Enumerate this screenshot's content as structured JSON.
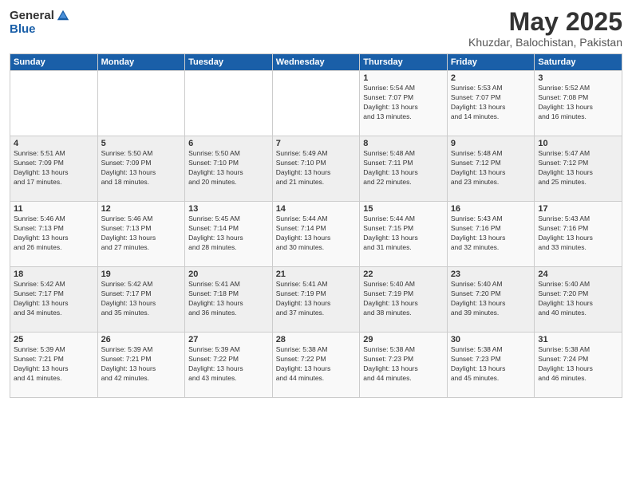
{
  "logo": {
    "general": "General",
    "blue": "Blue"
  },
  "header": {
    "title": "May 2025",
    "subtitle": "Khuzdar, Balochistan, Pakistan"
  },
  "weekdays": [
    "Sunday",
    "Monday",
    "Tuesday",
    "Wednesday",
    "Thursday",
    "Friday",
    "Saturday"
  ],
  "weeks": [
    [
      {
        "num": "",
        "info": ""
      },
      {
        "num": "",
        "info": ""
      },
      {
        "num": "",
        "info": ""
      },
      {
        "num": "",
        "info": ""
      },
      {
        "num": "1",
        "info": "Sunrise: 5:54 AM\nSunset: 7:07 PM\nDaylight: 13 hours\nand 13 minutes."
      },
      {
        "num": "2",
        "info": "Sunrise: 5:53 AM\nSunset: 7:07 PM\nDaylight: 13 hours\nand 14 minutes."
      },
      {
        "num": "3",
        "info": "Sunrise: 5:52 AM\nSunset: 7:08 PM\nDaylight: 13 hours\nand 16 minutes."
      }
    ],
    [
      {
        "num": "4",
        "info": "Sunrise: 5:51 AM\nSunset: 7:09 PM\nDaylight: 13 hours\nand 17 minutes."
      },
      {
        "num": "5",
        "info": "Sunrise: 5:50 AM\nSunset: 7:09 PM\nDaylight: 13 hours\nand 18 minutes."
      },
      {
        "num": "6",
        "info": "Sunrise: 5:50 AM\nSunset: 7:10 PM\nDaylight: 13 hours\nand 20 minutes."
      },
      {
        "num": "7",
        "info": "Sunrise: 5:49 AM\nSunset: 7:10 PM\nDaylight: 13 hours\nand 21 minutes."
      },
      {
        "num": "8",
        "info": "Sunrise: 5:48 AM\nSunset: 7:11 PM\nDaylight: 13 hours\nand 22 minutes."
      },
      {
        "num": "9",
        "info": "Sunrise: 5:48 AM\nSunset: 7:12 PM\nDaylight: 13 hours\nand 23 minutes."
      },
      {
        "num": "10",
        "info": "Sunrise: 5:47 AM\nSunset: 7:12 PM\nDaylight: 13 hours\nand 25 minutes."
      }
    ],
    [
      {
        "num": "11",
        "info": "Sunrise: 5:46 AM\nSunset: 7:13 PM\nDaylight: 13 hours\nand 26 minutes."
      },
      {
        "num": "12",
        "info": "Sunrise: 5:46 AM\nSunset: 7:13 PM\nDaylight: 13 hours\nand 27 minutes."
      },
      {
        "num": "13",
        "info": "Sunrise: 5:45 AM\nSunset: 7:14 PM\nDaylight: 13 hours\nand 28 minutes."
      },
      {
        "num": "14",
        "info": "Sunrise: 5:44 AM\nSunset: 7:14 PM\nDaylight: 13 hours\nand 30 minutes."
      },
      {
        "num": "15",
        "info": "Sunrise: 5:44 AM\nSunset: 7:15 PM\nDaylight: 13 hours\nand 31 minutes."
      },
      {
        "num": "16",
        "info": "Sunrise: 5:43 AM\nSunset: 7:16 PM\nDaylight: 13 hours\nand 32 minutes."
      },
      {
        "num": "17",
        "info": "Sunrise: 5:43 AM\nSunset: 7:16 PM\nDaylight: 13 hours\nand 33 minutes."
      }
    ],
    [
      {
        "num": "18",
        "info": "Sunrise: 5:42 AM\nSunset: 7:17 PM\nDaylight: 13 hours\nand 34 minutes."
      },
      {
        "num": "19",
        "info": "Sunrise: 5:42 AM\nSunset: 7:17 PM\nDaylight: 13 hours\nand 35 minutes."
      },
      {
        "num": "20",
        "info": "Sunrise: 5:41 AM\nSunset: 7:18 PM\nDaylight: 13 hours\nand 36 minutes."
      },
      {
        "num": "21",
        "info": "Sunrise: 5:41 AM\nSunset: 7:19 PM\nDaylight: 13 hours\nand 37 minutes."
      },
      {
        "num": "22",
        "info": "Sunrise: 5:40 AM\nSunset: 7:19 PM\nDaylight: 13 hours\nand 38 minutes."
      },
      {
        "num": "23",
        "info": "Sunrise: 5:40 AM\nSunset: 7:20 PM\nDaylight: 13 hours\nand 39 minutes."
      },
      {
        "num": "24",
        "info": "Sunrise: 5:40 AM\nSunset: 7:20 PM\nDaylight: 13 hours\nand 40 minutes."
      }
    ],
    [
      {
        "num": "25",
        "info": "Sunrise: 5:39 AM\nSunset: 7:21 PM\nDaylight: 13 hours\nand 41 minutes."
      },
      {
        "num": "26",
        "info": "Sunrise: 5:39 AM\nSunset: 7:21 PM\nDaylight: 13 hours\nand 42 minutes."
      },
      {
        "num": "27",
        "info": "Sunrise: 5:39 AM\nSunset: 7:22 PM\nDaylight: 13 hours\nand 43 minutes."
      },
      {
        "num": "28",
        "info": "Sunrise: 5:38 AM\nSunset: 7:22 PM\nDaylight: 13 hours\nand 44 minutes."
      },
      {
        "num": "29",
        "info": "Sunrise: 5:38 AM\nSunset: 7:23 PM\nDaylight: 13 hours\nand 44 minutes."
      },
      {
        "num": "30",
        "info": "Sunrise: 5:38 AM\nSunset: 7:23 PM\nDaylight: 13 hours\nand 45 minutes."
      },
      {
        "num": "31",
        "info": "Sunrise: 5:38 AM\nSunset: 7:24 PM\nDaylight: 13 hours\nand 46 minutes."
      }
    ]
  ]
}
